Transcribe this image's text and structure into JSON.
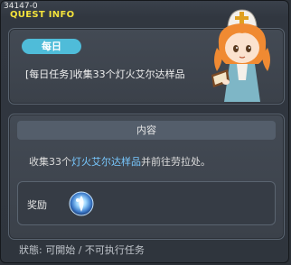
{
  "header": {
    "quest_id": "34147-0",
    "title": "QUEST INFO"
  },
  "quest": {
    "badge": "每日",
    "name": "[每日任务]收集33个灯火艾尔达样品"
  },
  "content": {
    "section_title": "内容",
    "desc_prefix": "收集33个",
    "desc_highlight": "灯火艾尔达样品",
    "desc_suffix": "并前往劳拉处。"
  },
  "reward": {
    "label": "奖励",
    "icon": "elda-sample-orb-icon"
  },
  "status": {
    "text": "狀態: 可開始 / 不可执行任务"
  },
  "colors": {
    "title": "#f3e23b",
    "badge": "#4fbcd9",
    "highlight": "#78c8ff"
  }
}
